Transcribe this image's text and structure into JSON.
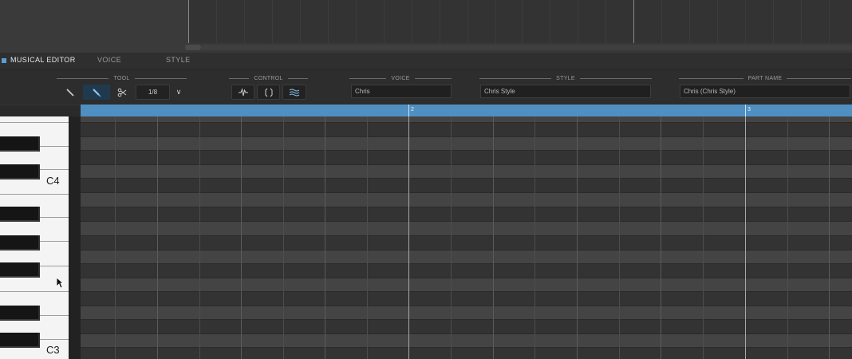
{
  "tabs": {
    "musical_editor": "MUSICAL EDITOR",
    "voice": "VOICE",
    "style": "STYLE"
  },
  "toolbar": {
    "tool_label": "TOOL",
    "control_label": "CONTROL",
    "voice_label": "VOICE",
    "style_label": "STYLE",
    "part_name_label": "PART NAME",
    "quantize_value": "1/8",
    "quantize_arrow": "∨",
    "voice_value": "Chris",
    "style_value": "Chris Style",
    "part_name_value": "Chris (Chris Style)",
    "icons": [
      "line-tool-icon",
      "pencil-tool-icon",
      "scissors-tool-icon",
      "vibrato-icon",
      "bracket-icon",
      "waves-icon"
    ]
  },
  "ruler": {
    "bar_2": "2",
    "bar_3": "3"
  },
  "keyboard": {
    "c4": "C4",
    "c3": "C3"
  },
  "colors": {
    "accent": "#4f8fc2",
    "active_button": "#1f3a4e"
  }
}
